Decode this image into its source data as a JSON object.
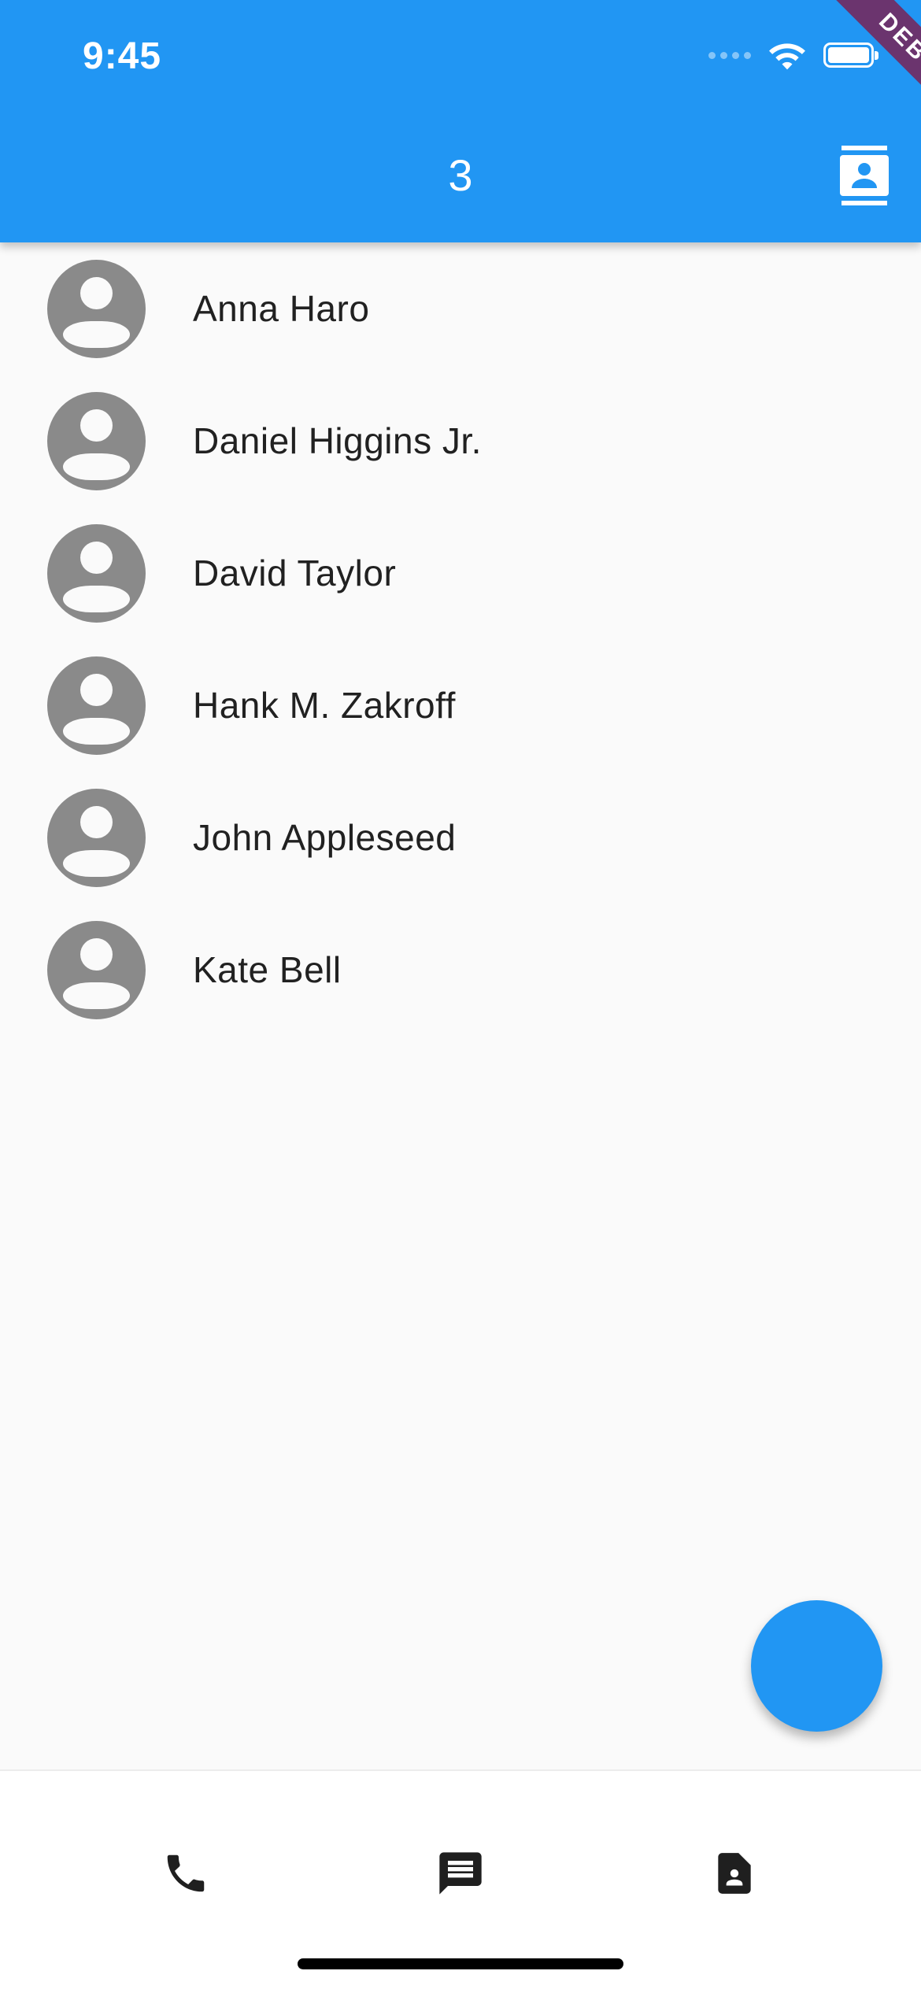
{
  "status_bar": {
    "time": "9:45",
    "icons": [
      "signal-icon",
      "wifi-icon",
      "battery-icon"
    ]
  },
  "debug_banner": {
    "label": "DEBUG"
  },
  "app_bar": {
    "title": "3",
    "action_icon": "contacts-icon",
    "background_color": "#2196f3"
  },
  "contacts": [
    {
      "name": "Anna Haro"
    },
    {
      "name": "Daniel Higgins Jr."
    },
    {
      "name": "David Taylor"
    },
    {
      "name": "Hank M. Zakroff"
    },
    {
      "name": "John Appleseed"
    },
    {
      "name": "Kate Bell"
    }
  ],
  "fab": {
    "color": "#2196f3"
  },
  "bottom_nav": {
    "items": [
      {
        "icon": "phone-icon"
      },
      {
        "icon": "message-icon"
      },
      {
        "icon": "contact-page-icon"
      }
    ]
  }
}
